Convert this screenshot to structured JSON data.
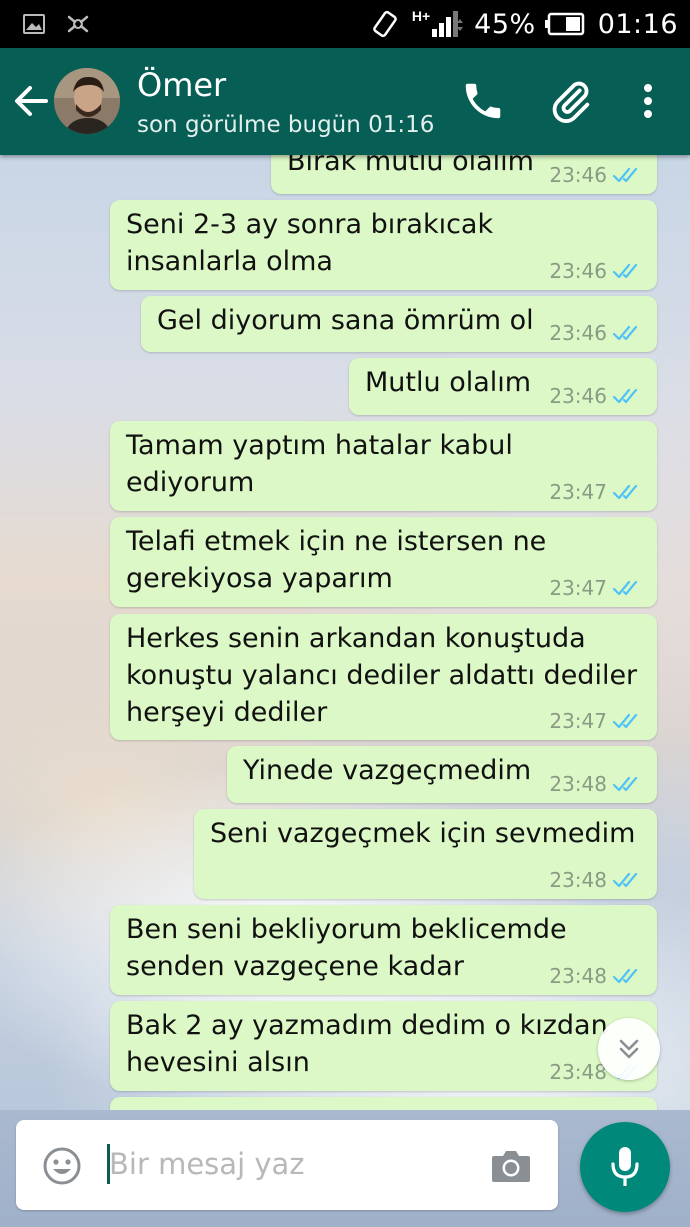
{
  "status_bar": {
    "network_label": "H+",
    "battery_percent": "45%",
    "time": "01:16",
    "icons": [
      "gallery-icon",
      "bug-icon",
      "rotate-icon",
      "signal-icon",
      "battery-icon"
    ]
  },
  "header": {
    "contact_name": "Ömer",
    "last_seen": "son görülme bugün 01:16",
    "icons": [
      "back-arrow-icon",
      "avatar",
      "phone-icon",
      "paperclip-icon",
      "more-vert-icon"
    ]
  },
  "messages": [
    {
      "text": "Bırak mutlu olalım",
      "time": "23:46",
      "status": "read"
    },
    {
      "text": "Seni 2-3 ay sonra bırakıcak\ninsanlarla olma",
      "time": "23:46",
      "status": "read"
    },
    {
      "text": "Gel diyorum sana ömrüm ol",
      "time": "23:46",
      "status": "read"
    },
    {
      "text": "Mutlu olalım",
      "time": "23:46",
      "status": "read"
    },
    {
      "text": "Tamam yaptım hatalar kabul\nediyorum",
      "time": "23:47",
      "status": "read"
    },
    {
      "text": "Telafi etmek için ne istersen ne\ngerekiyosa yaparım",
      "time": "23:47",
      "status": "read"
    },
    {
      "text": "Herkes senin arkandan konuştuda\nkonuştu yalancı dediler aldattı dediler\nherşeyi dediler",
      "time": "23:47",
      "status": "read"
    },
    {
      "text": "Yinede vazgeçmedim",
      "time": "23:48",
      "status": "read"
    },
    {
      "text": "Seni vazgeçmek için sevmedim",
      "time": "23:48",
      "status": "read"
    },
    {
      "text": "Ben seni bekliyorum beklicemde\nsenden vazgeçene kadar",
      "time": "23:48",
      "status": "read"
    },
    {
      "text": "Bak 2 ay yazmadım dedim o kızdan\nhevesini alsın",
      "time": "23:48",
      "status": "read"
    }
  ],
  "composer": {
    "placeholder": "Bir mesaj yaz",
    "value": "",
    "icons": [
      "emoji-icon",
      "camera-icon",
      "mic-icon",
      "scroll-down-icon"
    ]
  },
  "colors": {
    "app_bar": "#075E54",
    "outgoing_bubble": "#dcf8c6",
    "read_tick": "#4fc3f7",
    "mic_button": "#00897B"
  }
}
